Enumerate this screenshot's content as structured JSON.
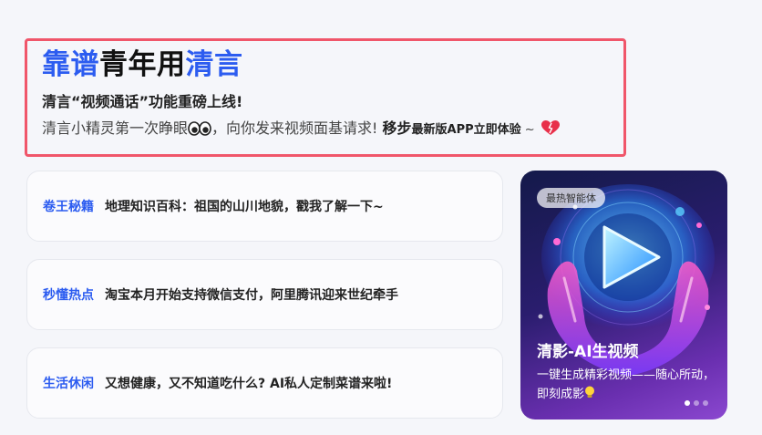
{
  "hero": {
    "title_part1": "靠谱",
    "title_part2": "青年用",
    "title_part3": "清言",
    "subtitle": "清言“视频通话”功能重磅上线!",
    "desc_prefix": "清言小精灵第一次睁眼",
    "desc_middle": "，向你发来视频面基请求!",
    "desc_strong": "移步",
    "desc_cta": "最新版APP立即体验",
    "desc_tilde": " ~ "
  },
  "cards": [
    {
      "tag": "卷王秘籍",
      "text": "地理知识百科：祖国的山川地貌，戳我了解一下~"
    },
    {
      "tag": "秒懂热点",
      "text": "淘宝本月开始支持微信支付，阿里腾讯迎来世纪牵手"
    },
    {
      "tag": "生活休闲",
      "text": "又想健康，又不知道吃什么? AI私人定制菜谱来啦!"
    }
  ],
  "promo": {
    "badge": "最热智能体",
    "title": "清影-AI生视频",
    "desc": "一键生成精彩视频——随心所动，即刻成影"
  },
  "colors": {
    "accent": "#2c5cf0",
    "hero_border": "#f0566a",
    "background": "#f5f6fa"
  },
  "icons": {
    "eyes": "eyes-icon",
    "heart": "heart-icon",
    "play": "play-icon",
    "bulb": "lightbulb-icon"
  }
}
